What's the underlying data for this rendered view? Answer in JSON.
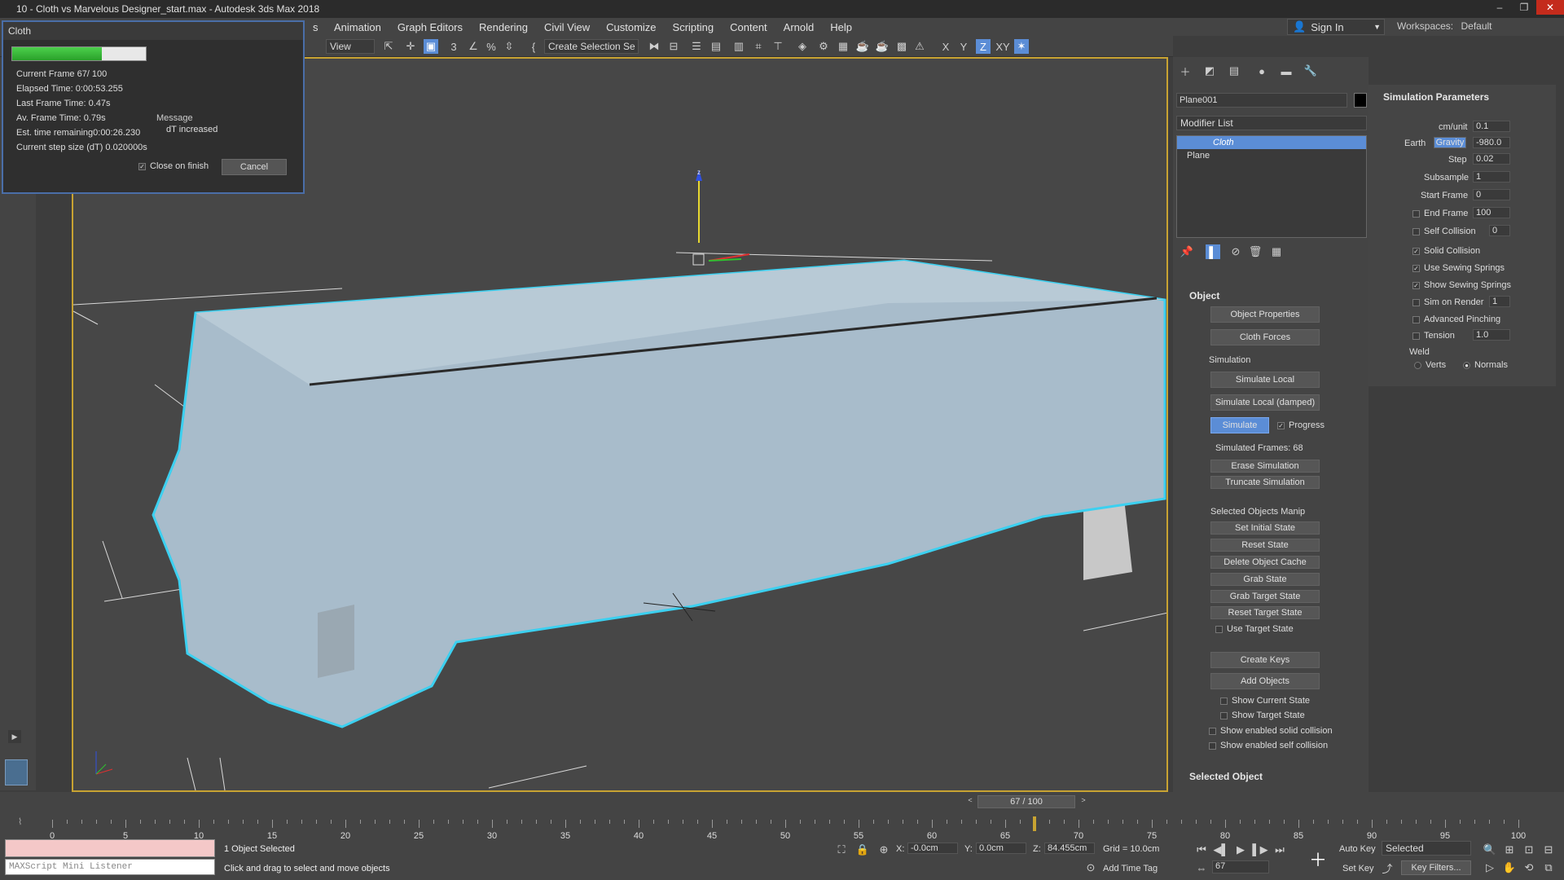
{
  "window": {
    "title": "10 - Cloth vs Marvelous Designer_start.max - Autodesk 3ds Max 2018",
    "controls": [
      "–",
      "❐",
      "✕"
    ]
  },
  "menu": {
    "items": [
      "Animation",
      "Graph Editors",
      "Rendering",
      "Civil View",
      "Customize",
      "Scripting",
      "Content",
      "Arnold",
      "Help"
    ],
    "hidden_prefix": "s",
    "sign_in": "Sign In",
    "workspaces_label": "Workspaces:",
    "workspaces_value": "Default"
  },
  "toolbar": {
    "view": "View",
    "selection_set": "Create Selection Se",
    "axes": [
      "X",
      "Y",
      "Z",
      "XY"
    ]
  },
  "cloth_dialog": {
    "title": "Cloth",
    "progress": 0.67,
    "current_frame": "Current Frame   67/  100",
    "elapsed": "Elapsed Time:  0:00:53.255",
    "last_frame": "Last Frame Time:   0.47s",
    "avg_frame": "Av. Frame Time:    0.79s",
    "est_remaining": "Est. time remaining0:00:26.230",
    "step_size": "Current step size (dT)  0.020000s",
    "message_label": "Message",
    "message": "dT increased",
    "close_on_finish": "Close on finish",
    "cancel": "Cancel"
  },
  "command_panel": {
    "object_name": "Plane001",
    "modifier_list": "Modifier List",
    "stack": [
      "Cloth",
      "Plane"
    ],
    "object_section": "Object",
    "object_properties": "Object Properties",
    "cloth_forces": "Cloth Forces",
    "simulation_label": "Simulation",
    "simulate_local": "Simulate Local",
    "simulate_local_damped": "Simulate Local (damped)",
    "simulate": "Simulate",
    "progress": "Progress",
    "simulated_frames": "Simulated Frames:   68",
    "erase_simulation": "Erase Simulation",
    "truncate_simulation": "Truncate Simulation",
    "selected_objects_manip": "Selected Objects Manip",
    "set_initial_state": "Set Initial State",
    "reset_state": "Reset State",
    "delete_object_cache": "Delete Object Cache",
    "grab_state": "Grab State",
    "grab_target_state": "Grab Target State",
    "reset_target_state": "Reset Target State",
    "use_target_state": "Use Target State",
    "create_keys": "Create Keys",
    "add_objects": "Add Objects",
    "show_current_state": "Show Current State",
    "show_target_state": "Show Target State",
    "show_solid_collision": "Show enabled solid collision",
    "show_self_collision": "Show enabled self collision",
    "selected_object": "Selected Object"
  },
  "sim_params": {
    "title": "Simulation Parameters",
    "cm_unit_label": "cm/unit",
    "cm_unit": "0.1",
    "earth": "Earth",
    "gravity": "Gravity",
    "gravity_value": "-980.0",
    "step_label": "Step",
    "step": "0.02",
    "subsample_label": "Subsample",
    "subsample": "1",
    "start_frame_label": "Start Frame",
    "start_frame": "0",
    "end_frame_label": "End Frame",
    "end_frame": "100",
    "self_collision_label": "Self Collision",
    "self_collision": "0",
    "solid_collision": "Solid Collision",
    "use_sewing": "Use Sewing Springs",
    "show_sewing": "Show Sewing Springs",
    "sim_on_render": "Sim on Render",
    "sim_on_render_val": "1",
    "advanced_pinching": "Advanced Pinching",
    "tension_label": "Tension",
    "tension": "1.0",
    "weld": "Weld",
    "verts": "Verts",
    "normals": "Normals"
  },
  "timeline": {
    "frame_display": "67 / 100",
    "current": 67,
    "ticks": [
      "0",
      "5",
      "10",
      "15",
      "20",
      "25",
      "30",
      "35",
      "40",
      "45",
      "50",
      "55",
      "60",
      "65",
      "70",
      "75",
      "80",
      "85",
      "90",
      "95",
      "100"
    ]
  },
  "status": {
    "listener": "MAXScript Mini Listener",
    "selected": "1 Object Selected",
    "hint": "Click and drag to select and move objects",
    "x_label": "X:",
    "x": "-0.0cm",
    "y_label": "Y:",
    "y": "0.0cm",
    "z_label": "Z:",
    "z": "84.455cm",
    "grid": "Grid = 10.0cm",
    "add_time_tag": "Add Time Tag",
    "auto_key": "Auto Key",
    "selected_dd": "Selected",
    "set_key": "Set Key",
    "key_filters": "Key Filters...",
    "frame": "67"
  }
}
